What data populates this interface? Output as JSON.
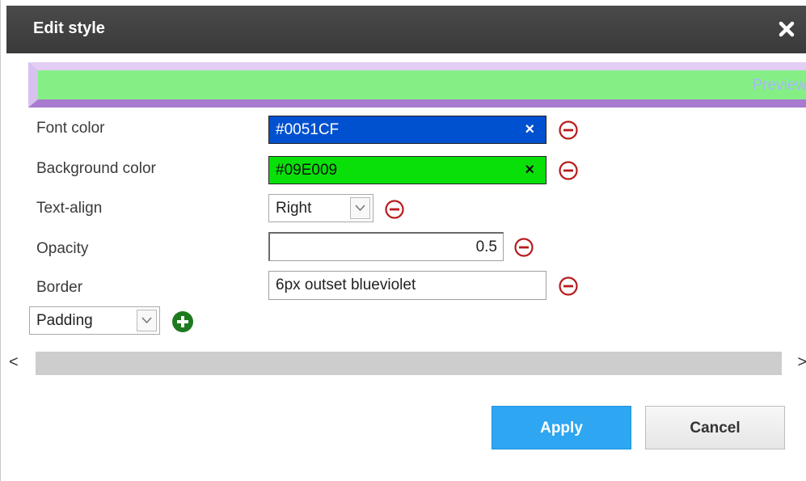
{
  "dialog": {
    "title": "Edit style",
    "close_icon": "close-icon"
  },
  "preview": {
    "text": "Preview",
    "background": "#85EF85",
    "text_color": "#A8B8F8"
  },
  "fields": {
    "font_color": {
      "label": "Font color",
      "value": "#0051CF",
      "clear": "×",
      "swatch": "#0051CF"
    },
    "background_color": {
      "label": "Background color",
      "value": "#09E009",
      "clear": "×",
      "swatch": "#09E009"
    },
    "text_align": {
      "label": "Text-align",
      "value": "Right"
    },
    "opacity": {
      "label": "Opacity",
      "value": "0.5"
    },
    "border": {
      "label": "Border",
      "value": "6px outset blueviolet"
    }
  },
  "add_property": {
    "selected": "Padding",
    "add_icon": "plus-circle-icon"
  },
  "scrollbar": {
    "left_arrow": "<",
    "right_arrow": ">"
  },
  "buttons": {
    "apply": "Apply",
    "cancel": "Cancel"
  },
  "colors": {
    "accent": "#2EA6F2",
    "remove_icon": "#B71C1C",
    "add_icon": "#1E7A1E"
  }
}
